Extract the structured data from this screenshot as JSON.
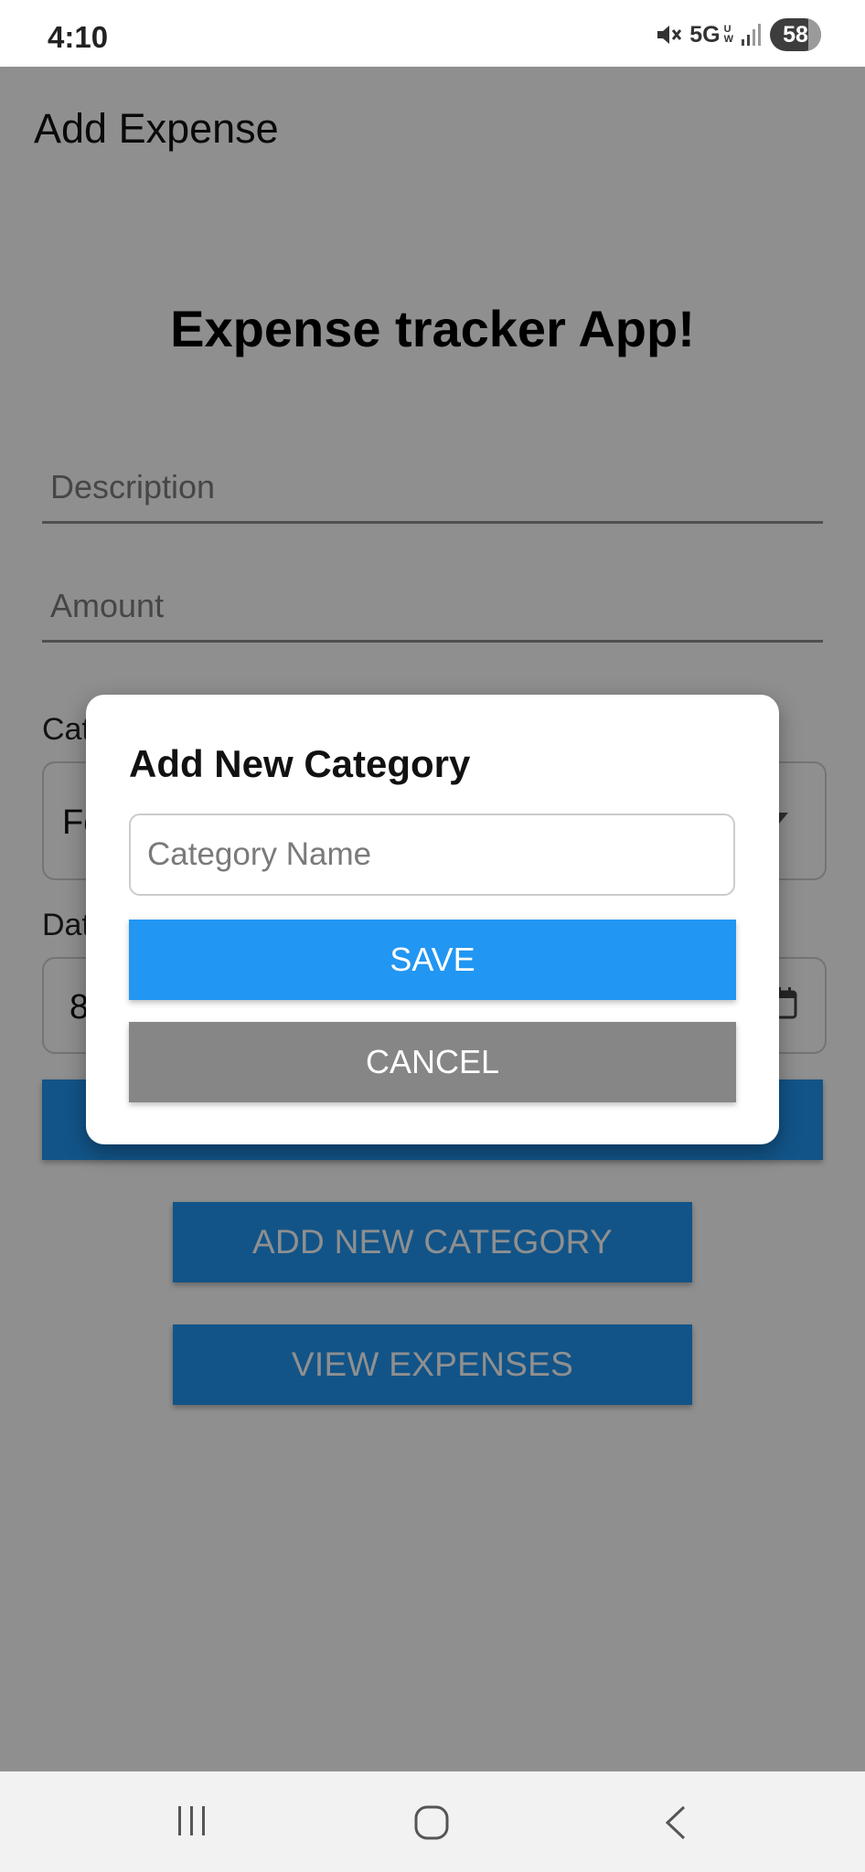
{
  "status_bar": {
    "time": "4:10",
    "network": "5G",
    "network_sup_top": "U",
    "network_sup_bottom": "W",
    "battery": "58"
  },
  "app_bar": {
    "title": "Add Expense"
  },
  "main": {
    "heading": "Expense tracker App!",
    "description_placeholder": "Description",
    "amount_placeholder": "Amount",
    "category_label": "Category",
    "category_value": "Food",
    "date_label": "Date",
    "date_value": "8",
    "add_new_category_label": "ADD NEW CATEGORY",
    "view_expenses_label": "VIEW EXPENSES"
  },
  "dialog": {
    "title": "Add New Category",
    "input_placeholder": "Category Name",
    "input_value": "",
    "save_label": "SAVE",
    "cancel_label": "CANCEL"
  },
  "colors": {
    "primary": "#2196f3",
    "cancel": "#868686",
    "scrim": "rgba(0,0,0,0.44)"
  },
  "icons": [
    "mute-icon",
    "signal-icon",
    "calendar-icon",
    "recents-icon",
    "home-icon",
    "back-icon"
  ]
}
